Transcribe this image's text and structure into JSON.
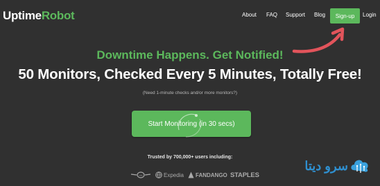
{
  "header": {
    "logo_part1": "Uptime",
    "logo_part2": "Robot",
    "nav": {
      "about": "About",
      "faq": "FAQ",
      "support": "Support",
      "blog": "Blog",
      "signup": "Sign-up",
      "login": "Login"
    }
  },
  "hero": {
    "tagline": "Downtime Happens. Get Notified!",
    "headline": "50 Monitors, Checked Every 5 Minutes, Totally Free!",
    "subnote": "(Need 1-minute checks and/or more monitors?)",
    "cta_label": "Start Monitoring (in 30 secs)"
  },
  "trusted": {
    "label": "Trusted by 700,000+ users including:",
    "brands": [
      "mini",
      "Expedia",
      "FANDANGO",
      "STAPLES"
    ]
  },
  "watermark": {
    "text": "سرو دیتا"
  },
  "colors": {
    "background": "#303030",
    "accent": "#5cb85c",
    "annotation_arrow": "#e2545b",
    "watermark": "#2f8fcf"
  },
  "icons": {
    "annotation": "curved-arrow-icon",
    "cta_overlay": "loading-spinner-icon",
    "brand_mini": "mini-logo-icon",
    "brand_expedia": "globe-icon"
  }
}
